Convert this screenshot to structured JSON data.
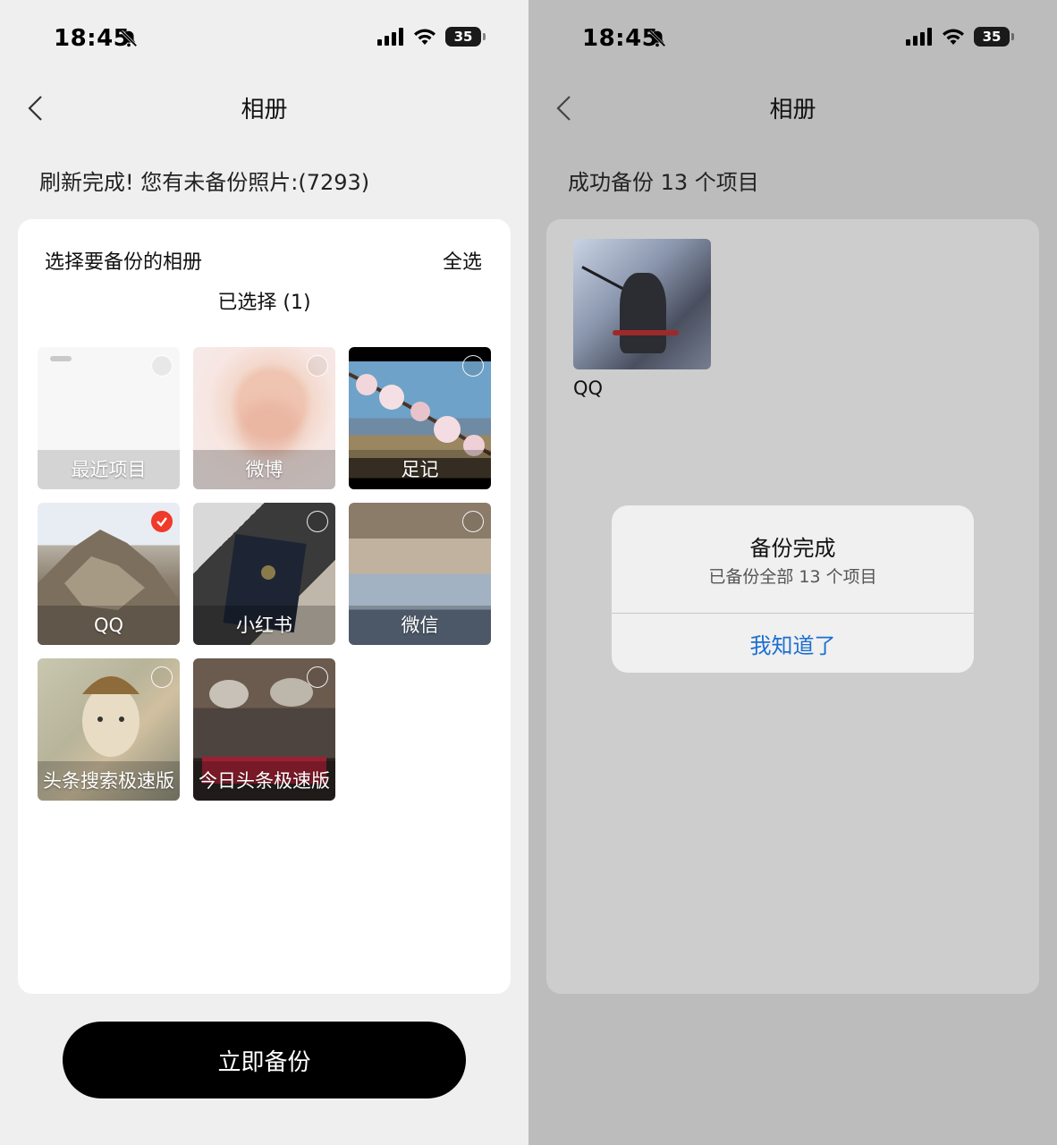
{
  "status": {
    "time": "18:45",
    "battery": "35"
  },
  "left": {
    "nav_title": "相册",
    "notice": "刷新完成! 您有未备份照片:(7293)",
    "card": {
      "heading": "选择要备份的相册",
      "select_all": "全选",
      "selected_count": "已选择 (1)"
    },
    "albums": [
      {
        "label": "最近项目",
        "selected": false
      },
      {
        "label": "微博",
        "selected": false
      },
      {
        "label": "足记",
        "selected": false
      },
      {
        "label": "QQ",
        "selected": true
      },
      {
        "label": "小红书",
        "selected": false
      },
      {
        "label": "微信",
        "selected": false
      },
      {
        "label": "头条搜索极速版",
        "selected": false
      },
      {
        "label": "今日头条极速版",
        "selected": false
      }
    ],
    "backup_button": "立即备份"
  },
  "right": {
    "nav_title": "相册",
    "notice": "成功备份 13 个项目",
    "album_name": "QQ",
    "dialog": {
      "title": "备份完成",
      "message": "已备份全部 13 个项目",
      "button": "我知道了"
    }
  },
  "colors": {
    "accent_red": "#f03a2a",
    "link_blue": "#1c6fd1",
    "button_black": "#000000"
  }
}
